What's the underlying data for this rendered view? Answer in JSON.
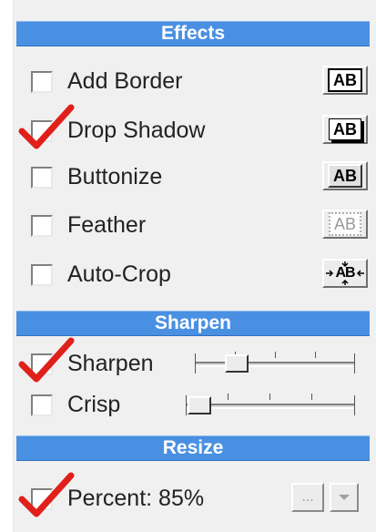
{
  "effects": {
    "header": "Effects",
    "items": [
      {
        "label": "Add Border",
        "checked": false,
        "preview_text": "AB"
      },
      {
        "label": "Drop Shadow",
        "checked": true,
        "preview_text": "AB"
      },
      {
        "label": "Buttonize",
        "checked": false,
        "preview_text": "AB"
      },
      {
        "label": "Feather",
        "checked": false,
        "preview_text": "AB"
      },
      {
        "label": "Auto-Crop",
        "checked": false,
        "preview_text": "AB"
      }
    ]
  },
  "sharpen": {
    "header": "Sharpen",
    "items": [
      {
        "label": "Sharpen",
        "checked": true
      },
      {
        "label": "Crisp",
        "checked": false
      }
    ]
  },
  "resize": {
    "header": "Resize",
    "items": [
      {
        "label": "Percent: 85%",
        "checked": true,
        "browse_label": "...",
        "dropdown_icon": "chevron-down-icon"
      }
    ]
  },
  "colors": {
    "header_bg": "#4a90e2",
    "checkmark": "#e0201b"
  }
}
